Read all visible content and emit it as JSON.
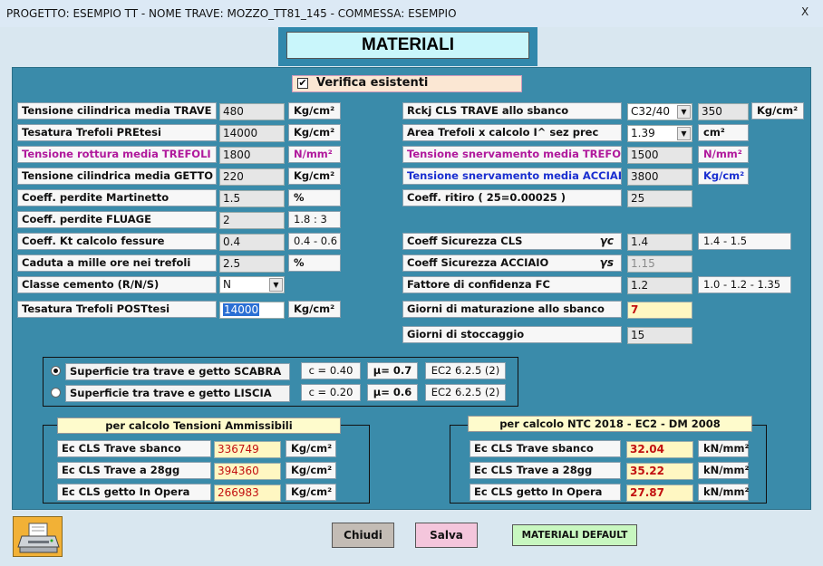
{
  "window": {
    "title": "PROGETTO: ESEMPIO TT - NOME TRAVE: MOZZO_TT81_145 - COMMESSA: ESEMPIO",
    "close": "X"
  },
  "header": {
    "title": "MATERIALI"
  },
  "verifica": {
    "checked": "✔",
    "label": "Verifica esistenti"
  },
  "left": {
    "tensione_cil_trave": {
      "label": "Tensione cilindrica media TRAVE",
      "value": "480",
      "unit": "Kg/cm²"
    },
    "tesatura_pre": {
      "label": "Tesatura Trefoli PREtesi",
      "value": "14000",
      "unit": "Kg/cm²"
    },
    "rottura_trefoli": {
      "label": "Tensione rottura media TREFOLI",
      "value": "1800",
      "unit": "N/mm²"
    },
    "tensione_cil_getto": {
      "label": "Tensione cilindrica media GETTO",
      "value": "220",
      "unit": "Kg/cm²"
    },
    "perdite_martinetto": {
      "label": "Coeff. perdite Martinetto",
      "value": "1.5",
      "unit": "%"
    },
    "perdite_fluage": {
      "label": "Coeff. perdite FLUAGE",
      "value": "2",
      "unit": "1.8 : 3"
    },
    "kt_fessure": {
      "label": "Coeff. Kt calcolo fessure",
      "value": "0.4",
      "unit": "0.4 - 0.6"
    },
    "caduta_mille": {
      "label": "Caduta a mille ore nei trefoli",
      "value": "2.5",
      "unit": "%"
    },
    "classe_cemento": {
      "label": "Classe cemento (R/N/S)",
      "value": "N"
    },
    "tesatura_post": {
      "label": "Tesatura Trefoli POSTtesi",
      "value": "14000",
      "unit": "Kg/cm²"
    }
  },
  "right": {
    "rckj": {
      "label": "Rckj CLS TRAVE allo sbanco",
      "combo": "C32/40",
      "value": "350",
      "unit": "Kg/cm²"
    },
    "area_trefoli": {
      "label": "Area Trefoli x calcolo I^ sez prec",
      "combo": "1.39",
      "unit": "cm²"
    },
    "snerv_trefoli": {
      "label": "Tensione snervamento media TREFOLI",
      "value": "1500",
      "unit": "N/mm²"
    },
    "snerv_acciaio": {
      "label": "Tensione snervamento media ACCIAIO",
      "value": "3800",
      "unit": "Kg/cm²"
    },
    "ritiro": {
      "label": "Coeff. ritiro ( 25=0.00025 )",
      "value": "25"
    },
    "sic_cls": {
      "label": "Coeff Sicurezza CLS",
      "symbol": "γc",
      "value": "1.4",
      "unit": "1.4 - 1.5"
    },
    "sic_acciaio": {
      "label": "Coeff Sicurezza ACCIAIO",
      "symbol": "γs",
      "value": "1.15"
    },
    "confidenza": {
      "label": "Fattore di confidenza FC",
      "value": "1.2",
      "unit": "1.0 - 1.2 - 1.35"
    },
    "giorni_maturazione": {
      "label": "Giorni di maturazione allo sbanco",
      "value": "7"
    },
    "giorni_stoccaggio": {
      "label": "Giorni di stoccaggio",
      "value": "15"
    }
  },
  "surface": {
    "scabra": {
      "label": "Superficie tra trave e getto SCABRA",
      "c": "c = 0.40",
      "mu": "μ= 0.7",
      "ref": "EC2 6.2.5 (2)",
      "selected": true
    },
    "liscia": {
      "label": "Superficie tra trave e getto LISCIA",
      "c": "c = 0.20",
      "mu": "μ= 0.6",
      "ref": "EC2 6.2.5 (2)",
      "selected": false
    }
  },
  "ammissibili": {
    "title": "per calcolo Tensioni Ammissibili",
    "rows": [
      {
        "label": "Ec CLS Trave sbanco",
        "value": "336749",
        "unit": "Kg/cm²"
      },
      {
        "label": "Ec CLS Trave a 28gg",
        "value": "394360",
        "unit": "Kg/cm²"
      },
      {
        "label": "Ec CLS getto In Opera",
        "value": "266983",
        "unit": "Kg/cm²"
      }
    ]
  },
  "ntc": {
    "title": "per calcolo NTC 2018 - EC2 - DM 2008",
    "rows": [
      {
        "label": "Ec CLS Trave sbanco",
        "value": "32.04",
        "unit": "kN/mm²"
      },
      {
        "label": "Ec CLS Trave a 28gg",
        "value": "35.22",
        "unit": "kN/mm²"
      },
      {
        "label": "Ec CLS getto In Opera",
        "value": "27.87",
        "unit": "kN/mm²"
      }
    ]
  },
  "buttons": {
    "chiudi": "Chiudi",
    "salva": "Salva",
    "default": "MATERIALI DEFAULT"
  },
  "colors": {
    "panel": "#3a8baa",
    "header_bg": "#c9f6fb",
    "magenta": "#b0199c",
    "blue": "#1a2fd0",
    "yellow_field": "#fff7c2",
    "red_text": "#c21010"
  }
}
